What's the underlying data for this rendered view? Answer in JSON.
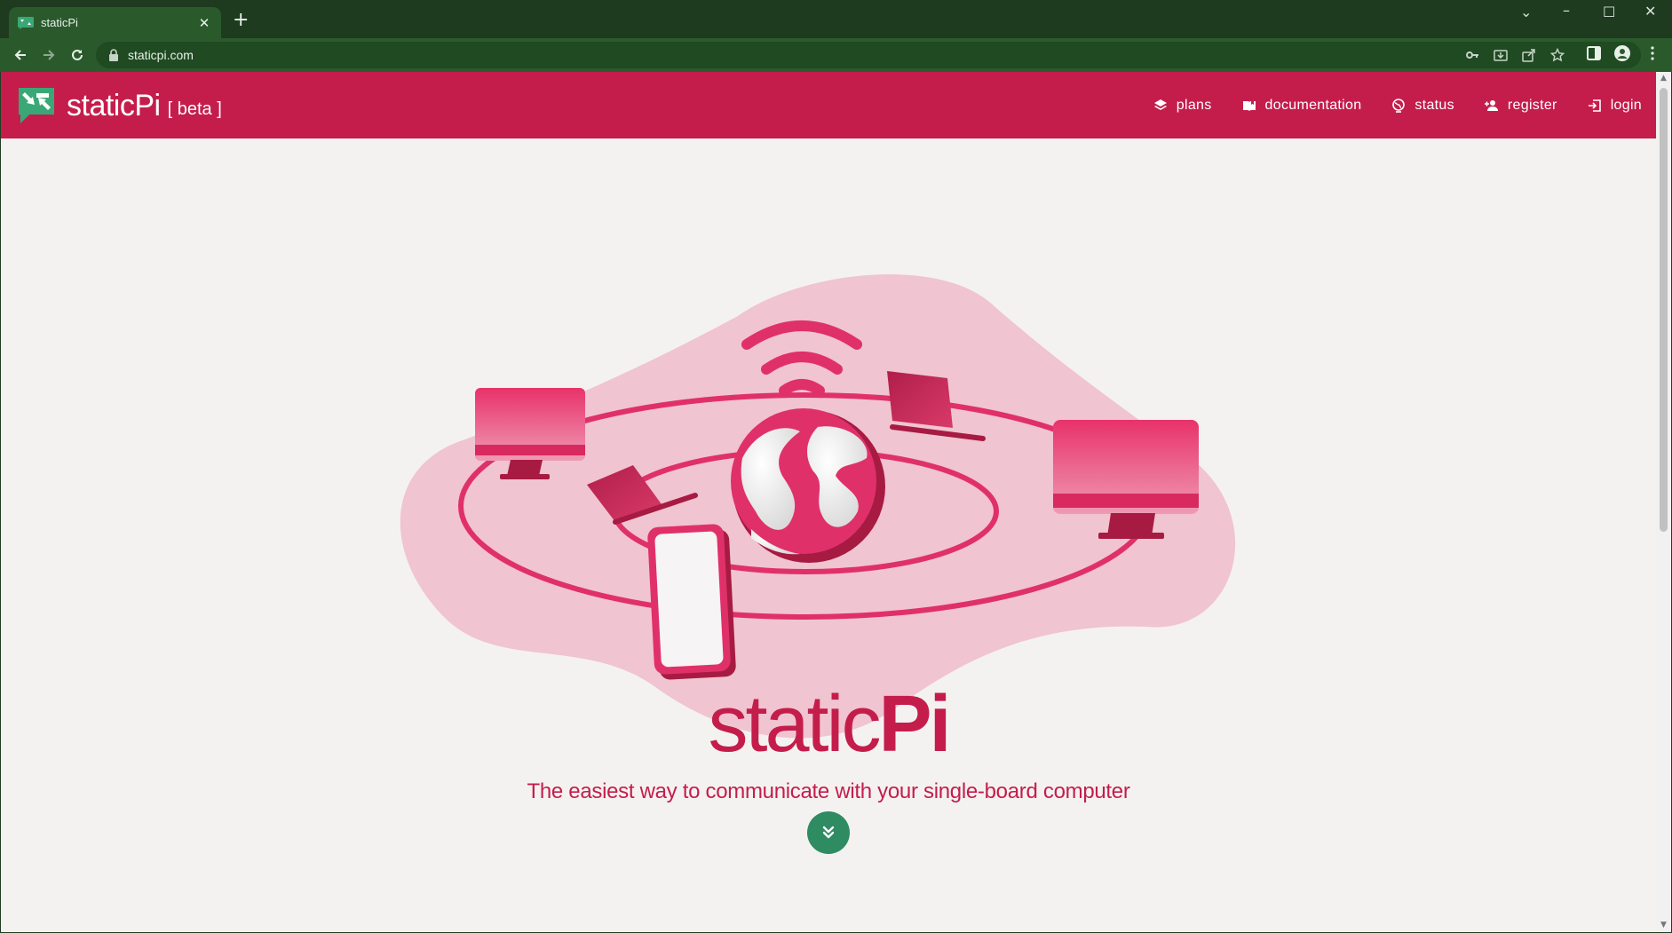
{
  "browser": {
    "tab_title": "staticPi",
    "url": "staticpi.com"
  },
  "site": {
    "brand_name": "staticPi",
    "brand_tag": "[ beta ]",
    "nav": [
      {
        "label": "plans",
        "icon": "layers-icon"
      },
      {
        "label": "documentation",
        "icon": "book-icon"
      },
      {
        "label": "status",
        "icon": "globe-icon"
      },
      {
        "label": "register",
        "icon": "user-plus-icon"
      },
      {
        "label": "login",
        "icon": "login-icon"
      }
    ]
  },
  "hero": {
    "title_light": "static",
    "title_bold": "Pi",
    "subtitle": "The easiest way to communicate with your single-board computer"
  },
  "colors": {
    "brand": "#c41d4c",
    "accent_green": "#2e8b62",
    "browser_frame": "#2a5a2c",
    "page_bg": "#f4f2f0",
    "blob": "#f0c4d0"
  }
}
